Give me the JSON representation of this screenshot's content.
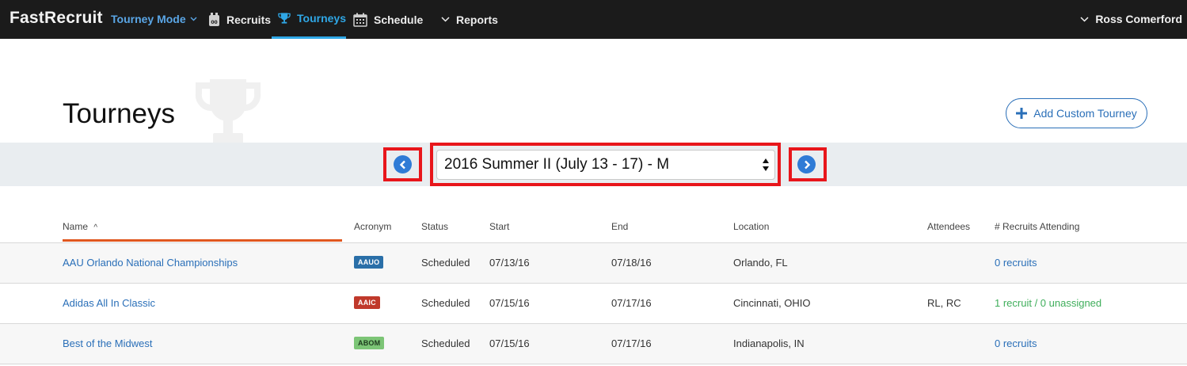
{
  "nav": {
    "brand": "FastRecruit",
    "mode": "Tourney Mode",
    "items": [
      {
        "label": "Recruits",
        "icon": "recruits-icon"
      },
      {
        "label": "Tourneys",
        "icon": "trophy-icon"
      },
      {
        "label": "Schedule",
        "icon": "calendar-icon"
      },
      {
        "label": "Reports",
        "icon": "chevron-down-icon"
      }
    ],
    "user": "Ross Comerford"
  },
  "page": {
    "title": "Tourneys",
    "add_button": "Add Custom Tourney"
  },
  "selector": {
    "value": "2016 Summer II (July 13 - 17) - M"
  },
  "table": {
    "columns": [
      "Name",
      "Acronym",
      "Status",
      "Start",
      "End",
      "Location",
      "Attendees",
      "# Recruits Attending"
    ],
    "sort_indicator": "^",
    "rows": [
      {
        "name": "AAU Orlando National Championships",
        "acronym": "AAUO",
        "status": "Scheduled",
        "start": "07/13/16",
        "end": "07/18/16",
        "location": "Orlando, FL",
        "attendees": "",
        "recruits": "0 recruits"
      },
      {
        "name": "Adidas All In Classic",
        "acronym": "AAIC",
        "status": "Scheduled",
        "start": "07/15/16",
        "end": "07/17/16",
        "location": "Cincinnati, OHIO",
        "attendees": "RL, RC",
        "recruits": "1 recruit / 0 unassigned"
      },
      {
        "name": "Best of the Midwest",
        "acronym": "ABOM",
        "status": "Scheduled",
        "start": "07/15/16",
        "end": "07/17/16",
        "location": "Indianapolis, IN",
        "attendees": "",
        "recruits": "0 recruits"
      }
    ]
  },
  "colors": {
    "nav_bg": "#1b1b1b",
    "active": "#2fa7e6",
    "link": "#2a6fb8",
    "sort_underline": "#e0571f",
    "highlight": "#e8161b",
    "badge_aauo": "#2a6fa8",
    "badge_aaic": "#c0392b",
    "badge_abom": "#7cc576",
    "green_text": "#3fae5b"
  }
}
